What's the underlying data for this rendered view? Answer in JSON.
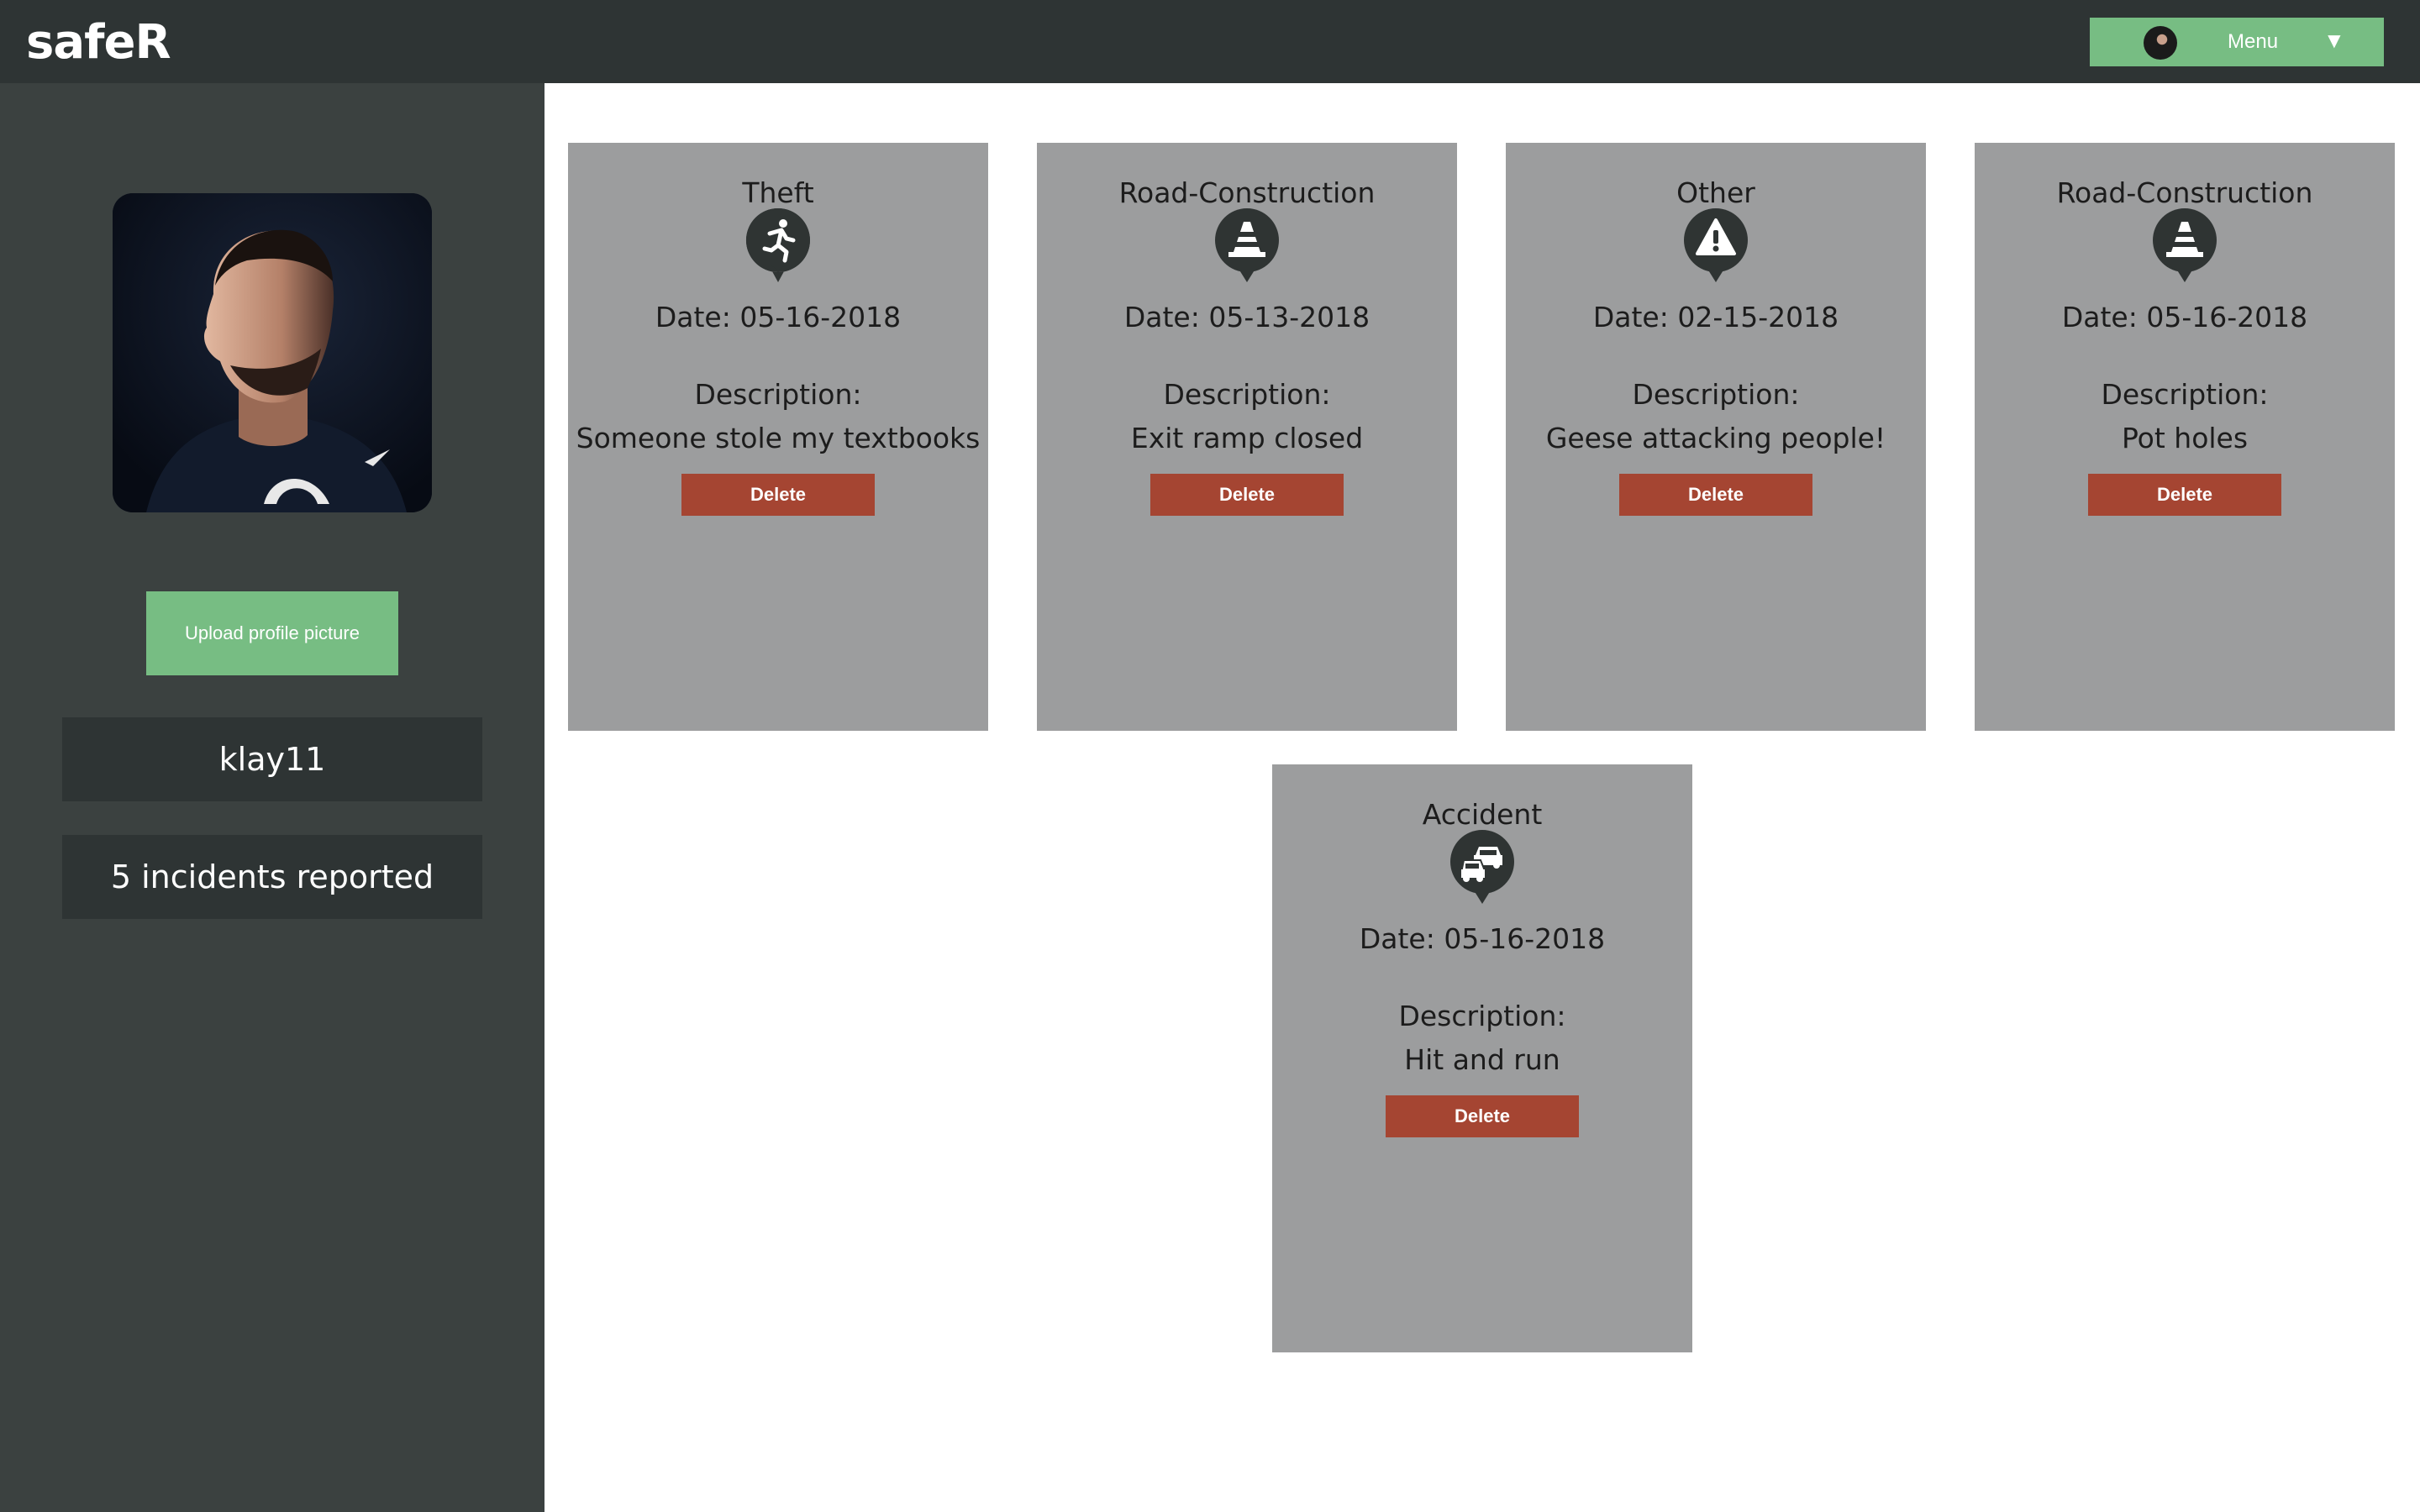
{
  "header": {
    "logo": "safeR",
    "menu_label": "Menu",
    "menu_caret": "▼"
  },
  "sidebar": {
    "upload_label": "Upload profile picture",
    "username": "klay11",
    "incident_count": "5 incidents reported"
  },
  "incidents": [
    {
      "type": "Theft",
      "icon": "running-person-icon",
      "date": "Date: 05-16-2018",
      "desc_label": "Description:",
      "description": "Someone stole my textbooks",
      "delete_label": "Delete"
    },
    {
      "type": "Road-Construction",
      "icon": "traffic-cone-icon",
      "date": "Date: 05-13-2018",
      "desc_label": "Description:",
      "description": "Exit ramp closed",
      "delete_label": "Delete"
    },
    {
      "type": "Other",
      "icon": "warning-icon",
      "date": "Date: 02-15-2018",
      "desc_label": "Description:",
      "description": "Geese attacking people!",
      "delete_label": "Delete"
    },
    {
      "type": "Road-Construction",
      "icon": "traffic-cone-icon",
      "date": "Date: 05-16-2018",
      "desc_label": "Description:",
      "description": "Pot holes",
      "delete_label": "Delete"
    },
    {
      "type": "Accident",
      "icon": "car-crash-icon",
      "date": "Date: 05-16-2018",
      "desc_label": "Description:",
      "description": "Hit and run",
      "delete_label": "Delete"
    }
  ],
  "colors": {
    "topbar": "#2e3434",
    "sidebar": "#3b4140",
    "accent_green": "#77bd83",
    "card": "#9c9d9e",
    "delete": "#a54532",
    "icon_marker": "#2f3433"
  }
}
